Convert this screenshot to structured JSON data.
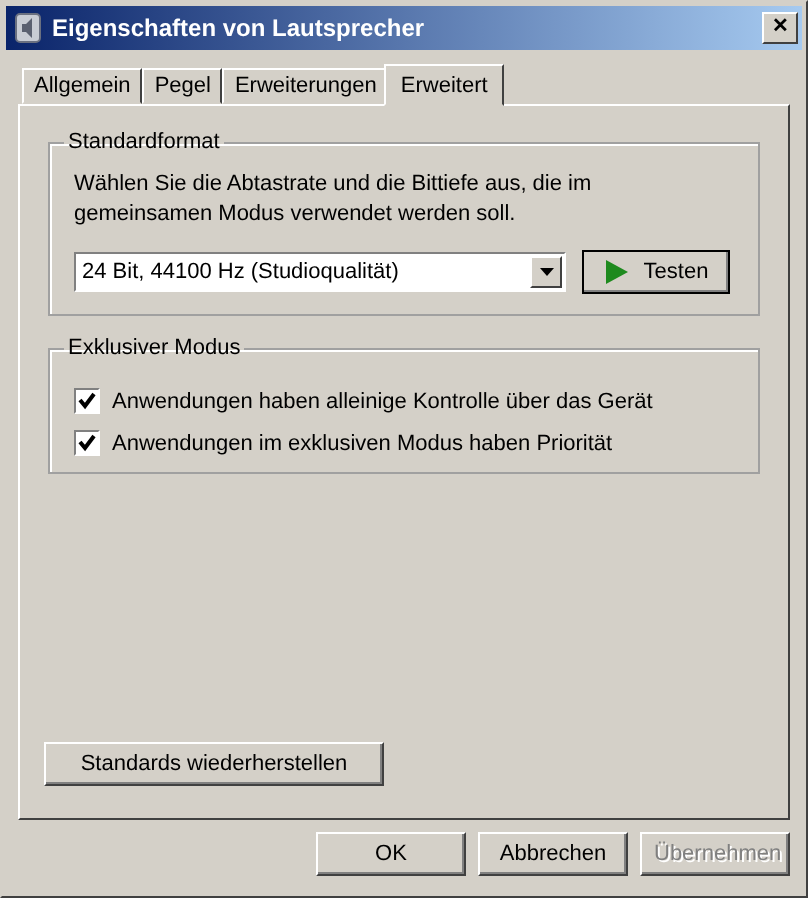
{
  "window": {
    "title": "Eigenschaften von Lautsprecher",
    "close": "✕"
  },
  "tabs": [
    {
      "label": "Allgemein",
      "selected": false
    },
    {
      "label": "Pegel",
      "selected": false
    },
    {
      "label": "Erweiterungen",
      "selected": false
    },
    {
      "label": "Erweitert",
      "selected": true
    }
  ],
  "standardformat": {
    "title": "Standardformat",
    "description": "Wählen Sie die Abtastrate und die Bittiefe aus, die im gemeinsamen Modus verwendet werden soll.",
    "format": "24 Bit, 44100 Hz (Studioqualität)",
    "test_button": "Testen"
  },
  "exclusive": {
    "title": "Exklusiver Modus",
    "options": [
      {
        "label": "Anwendungen haben alleinige Kontrolle über das Gerät",
        "checked": true
      },
      {
        "label": "Anwendungen im exklusiven Modus haben Priorität",
        "checked": true
      }
    ]
  },
  "restore_button": "Standards wiederherstellen",
  "buttons": [
    {
      "label": "OK",
      "disabled": false
    },
    {
      "label": "Abbrechen",
      "disabled": false
    },
    {
      "label": "Übernehmen",
      "disabled": true
    }
  ]
}
